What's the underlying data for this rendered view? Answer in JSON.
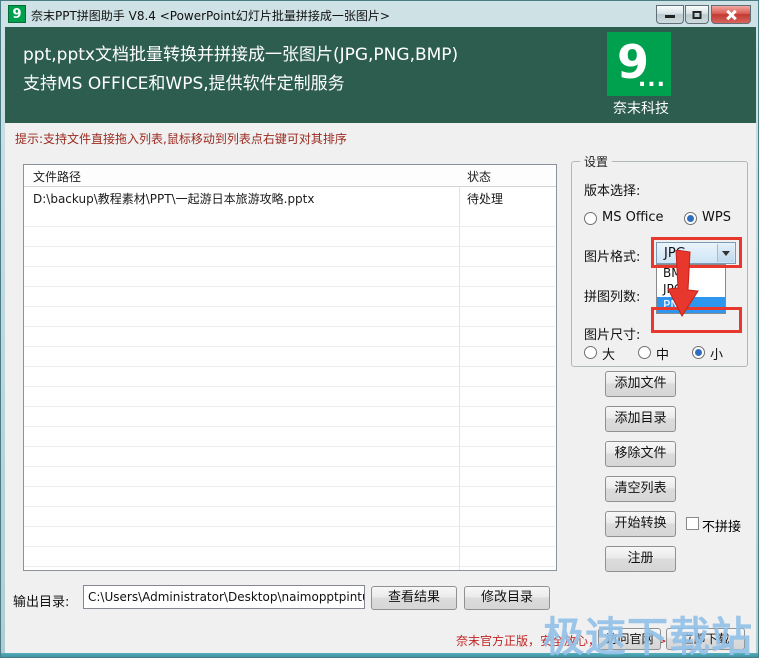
{
  "window": {
    "title": "奈末PPT拼图助手 V8.4 <PowerPoint幻灯片批量拼接成一张图片>",
    "icon_text": "9"
  },
  "banner": {
    "line1": "ppt,pptx文档批量转换并拼接成一张图片(JPG,PNG,BMP)",
    "line2": "支持MS OFFICE和WPS,提供软件定制服务",
    "logo_text": "9",
    "logo_dots": "...",
    "logo_caption": "奈末科技"
  },
  "hint": "提示:支持文件直接拖入列表,鼠标移动到列表点右键可对其排序",
  "file_list": {
    "col_path": "文件路径",
    "col_status": "状态",
    "rows": [
      {
        "path": "D:\\backup\\教程素材\\PPT\\一起游日本旅游攻略.pptx",
        "status": "待处理"
      }
    ]
  },
  "settings": {
    "legend": "设置",
    "version_label": "版本选择:",
    "radio_ms_office": "MS Office",
    "radio_wps": "WPS",
    "format_label": "图片格式:",
    "format_value": "JPG",
    "format_options": [
      "BMP",
      "JPG",
      "PNG"
    ],
    "columns_label": "拼图列数:",
    "size_label": "图片尺寸:",
    "size_options": [
      "大",
      "中",
      "小"
    ]
  },
  "actions": {
    "add_files": "添加文件",
    "add_dir": "添加目录",
    "remove_files": "移除文件",
    "clear_list": "清空列表",
    "start_convert": "开始转换",
    "no_stitch": "不拼接",
    "register": "注册"
  },
  "output": {
    "label": "输出目录:",
    "path": "C:\\Users\\Administrator\\Desktop\\naimopptpintuzhu",
    "view_button": "查看结果",
    "change_button": "修改目录"
  },
  "footer": {
    "promo": "奈末官方正版，安全放心，官方下载-->",
    "visit_button": "访问官网",
    "download_button": "立即下载",
    "watermark": "极速下载站"
  },
  "colors": {
    "banner_green": "#2c5d4e",
    "logo_green": "#00a14e",
    "hint_red": "#9b2a20",
    "annotation_red": "#e8372d",
    "dropdown_highlight": "#2f96ef",
    "watermark_blue": "#93c1e8"
  }
}
